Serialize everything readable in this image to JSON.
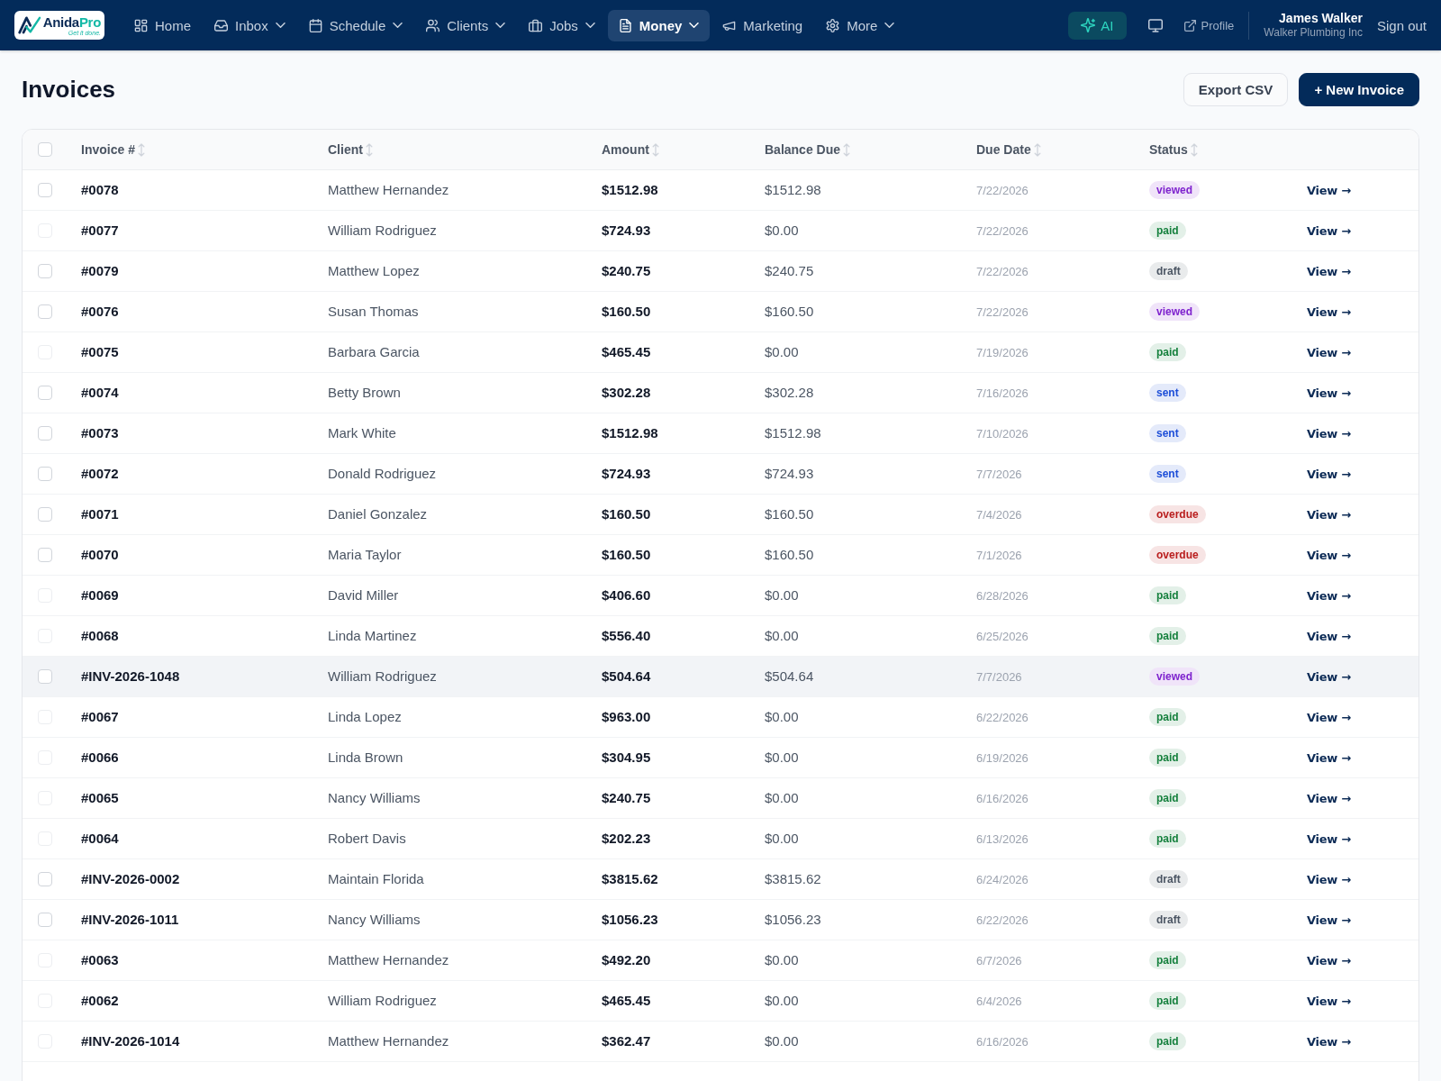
{
  "nav": {
    "logo": {
      "wordmark": [
        "Anida",
        "Pro"
      ],
      "tagline": "Get it done."
    },
    "items": [
      {
        "label": "Home",
        "dropdown": false,
        "selected": false
      },
      {
        "label": "Inbox",
        "dropdown": true,
        "selected": false
      },
      {
        "label": "Schedule",
        "dropdown": true,
        "selected": false
      },
      {
        "label": "Clients",
        "dropdown": true,
        "selected": false
      },
      {
        "label": "Jobs",
        "dropdown": true,
        "selected": false
      },
      {
        "label": "Money",
        "dropdown": true,
        "selected": true
      },
      {
        "label": "Marketing",
        "dropdown": false,
        "selected": false
      },
      {
        "label": "More",
        "dropdown": true,
        "selected": false
      }
    ],
    "ai_button": {
      "label": "AI"
    },
    "profile_link": {
      "label": "Profile"
    },
    "user": {
      "name": "James Walker",
      "company": "Walker Plumbing Inc"
    },
    "sign_out": "Sign out"
  },
  "page": {
    "title": "Invoices",
    "buttons": [
      {
        "label": "Export CSV",
        "kind": "secondary"
      },
      {
        "label": "+ New Invoice",
        "kind": "primary"
      }
    ]
  },
  "table": {
    "select_all": {
      "checked": false
    },
    "columns": [
      {
        "label": "Invoice #",
        "sortable": true
      },
      {
        "label": "Client",
        "sortable": true
      },
      {
        "label": "Amount",
        "sortable": true
      },
      {
        "label": "Balance Due",
        "sortable": true
      },
      {
        "label": "Due Date",
        "sortable": true
      },
      {
        "label": "Status",
        "sortable": true
      }
    ],
    "rows": [
      {
        "checked": false,
        "disabled": false,
        "highlighted": false,
        "invoice": "#0078",
        "client": "Matthew Hernandez",
        "amount": "$1512.98",
        "balance_due": "$1512.98",
        "due_date": "7/22/2026",
        "status": {
          "label": "viewed",
          "color": "#7e22ce"
        },
        "action": "View →"
      },
      {
        "checked": false,
        "disabled": true,
        "highlighted": false,
        "invoice": "#0077",
        "client": "William Rodriguez",
        "amount": "$724.93",
        "balance_due": "$0.00",
        "due_date": "7/22/2026",
        "status": {
          "label": "paid",
          "color": "#15803d"
        },
        "action": "View →"
      },
      {
        "checked": false,
        "disabled": false,
        "highlighted": false,
        "invoice": "#0079",
        "client": "Matthew Lopez",
        "amount": "$240.75",
        "balance_due": "$240.75",
        "due_date": "7/22/2026",
        "status": {
          "label": "draft",
          "color": "#4b5563"
        },
        "action": "View →"
      },
      {
        "checked": false,
        "disabled": false,
        "highlighted": false,
        "invoice": "#0076",
        "client": "Susan Thomas",
        "amount": "$160.50",
        "balance_due": "$160.50",
        "due_date": "7/22/2026",
        "status": {
          "label": "viewed",
          "color": "#7e22ce"
        },
        "action": "View →"
      },
      {
        "checked": false,
        "disabled": true,
        "highlighted": false,
        "invoice": "#0075",
        "client": "Barbara Garcia",
        "amount": "$465.45",
        "balance_due": "$0.00",
        "due_date": "7/19/2026",
        "status": {
          "label": "paid",
          "color": "#15803d"
        },
        "action": "View →"
      },
      {
        "checked": false,
        "disabled": false,
        "highlighted": false,
        "invoice": "#0074",
        "client": "Betty Brown",
        "amount": "$302.28",
        "balance_due": "$302.28",
        "due_date": "7/16/2026",
        "status": {
          "label": "sent",
          "color": "#1d4ed8"
        },
        "action": "View →"
      },
      {
        "checked": false,
        "disabled": false,
        "highlighted": false,
        "invoice": "#0073",
        "client": "Mark White",
        "amount": "$1512.98",
        "balance_due": "$1512.98",
        "due_date": "7/10/2026",
        "status": {
          "label": "sent",
          "color": "#1d4ed8"
        },
        "action": "View →"
      },
      {
        "checked": false,
        "disabled": false,
        "highlighted": false,
        "invoice": "#0072",
        "client": "Donald Rodriguez",
        "amount": "$724.93",
        "balance_due": "$724.93",
        "due_date": "7/7/2026",
        "status": {
          "label": "sent",
          "color": "#1d4ed8"
        },
        "action": "View →"
      },
      {
        "checked": false,
        "disabled": false,
        "highlighted": false,
        "invoice": "#0071",
        "client": "Daniel Gonzalez",
        "amount": "$160.50",
        "balance_due": "$160.50",
        "due_date": "7/4/2026",
        "status": {
          "label": "overdue",
          "color": "#b91c1c"
        },
        "action": "View →"
      },
      {
        "checked": false,
        "disabled": false,
        "highlighted": false,
        "invoice": "#0070",
        "client": "Maria Taylor",
        "amount": "$160.50",
        "balance_due": "$160.50",
        "due_date": "7/1/2026",
        "status": {
          "label": "overdue",
          "color": "#b91c1c"
        },
        "action": "View →"
      },
      {
        "checked": false,
        "disabled": true,
        "highlighted": false,
        "invoice": "#0069",
        "client": "David Miller",
        "amount": "$406.60",
        "balance_due": "$0.00",
        "due_date": "6/28/2026",
        "status": {
          "label": "paid",
          "color": "#15803d"
        },
        "action": "View →"
      },
      {
        "checked": false,
        "disabled": true,
        "highlighted": false,
        "invoice": "#0068",
        "client": "Linda Martinez",
        "amount": "$556.40",
        "balance_due": "$0.00",
        "due_date": "6/25/2026",
        "status": {
          "label": "paid",
          "color": "#15803d"
        },
        "action": "View →"
      },
      {
        "checked": false,
        "disabled": false,
        "highlighted": true,
        "invoice": "#INV-2026-1048",
        "client": "William Rodriguez",
        "amount": "$504.64",
        "balance_due": "$504.64",
        "due_date": "7/7/2026",
        "status": {
          "label": "viewed",
          "color": "#7e22ce"
        },
        "action": "View →"
      },
      {
        "checked": false,
        "disabled": true,
        "highlighted": false,
        "invoice": "#0067",
        "client": "Linda Lopez",
        "amount": "$963.00",
        "balance_due": "$0.00",
        "due_date": "6/22/2026",
        "status": {
          "label": "paid",
          "color": "#15803d"
        },
        "action": "View →"
      },
      {
        "checked": false,
        "disabled": true,
        "highlighted": false,
        "invoice": "#0066",
        "client": "Linda Brown",
        "amount": "$304.95",
        "balance_due": "$0.00",
        "due_date": "6/19/2026",
        "status": {
          "label": "paid",
          "color": "#15803d"
        },
        "action": "View →"
      },
      {
        "checked": false,
        "disabled": true,
        "highlighted": false,
        "invoice": "#0065",
        "client": "Nancy Williams",
        "amount": "$240.75",
        "balance_due": "$0.00",
        "due_date": "6/16/2026",
        "status": {
          "label": "paid",
          "color": "#15803d"
        },
        "action": "View →"
      },
      {
        "checked": false,
        "disabled": true,
        "highlighted": false,
        "invoice": "#0064",
        "client": "Robert Davis",
        "amount": "$202.23",
        "balance_due": "$0.00",
        "due_date": "6/13/2026",
        "status": {
          "label": "paid",
          "color": "#15803d"
        },
        "action": "View →"
      },
      {
        "checked": false,
        "disabled": false,
        "highlighted": false,
        "invoice": "#INV-2026-0002",
        "client": "Maintain Florida",
        "amount": "$3815.62",
        "balance_due": "$3815.62",
        "due_date": "6/24/2026",
        "status": {
          "label": "draft",
          "color": "#4b5563"
        },
        "action": "View →"
      },
      {
        "checked": false,
        "disabled": false,
        "highlighted": false,
        "invoice": "#INV-2026-1011",
        "client": "Nancy Williams",
        "amount": "$1056.23",
        "balance_due": "$1056.23",
        "due_date": "6/22/2026",
        "status": {
          "label": "draft",
          "color": "#4b5563"
        },
        "action": "View →"
      },
      {
        "checked": false,
        "disabled": true,
        "highlighted": false,
        "invoice": "#0063",
        "client": "Matthew Hernandez",
        "amount": "$492.20",
        "balance_due": "$0.00",
        "due_date": "6/7/2026",
        "status": {
          "label": "paid",
          "color": "#15803d"
        },
        "action": "View →"
      },
      {
        "checked": false,
        "disabled": true,
        "highlighted": false,
        "invoice": "#0062",
        "client": "William Rodriguez",
        "amount": "$465.45",
        "balance_due": "$0.00",
        "due_date": "6/4/2026",
        "status": {
          "label": "paid",
          "color": "#15803d"
        },
        "action": "View →"
      },
      {
        "checked": false,
        "disabled": true,
        "highlighted": false,
        "invoice": "#INV-2026-1014",
        "client": "Matthew Hernandez",
        "amount": "$362.47",
        "balance_due": "$0.00",
        "due_date": "6/16/2026",
        "status": {
          "label": "paid",
          "color": "#15803d"
        },
        "action": "View →"
      }
    ]
  }
}
